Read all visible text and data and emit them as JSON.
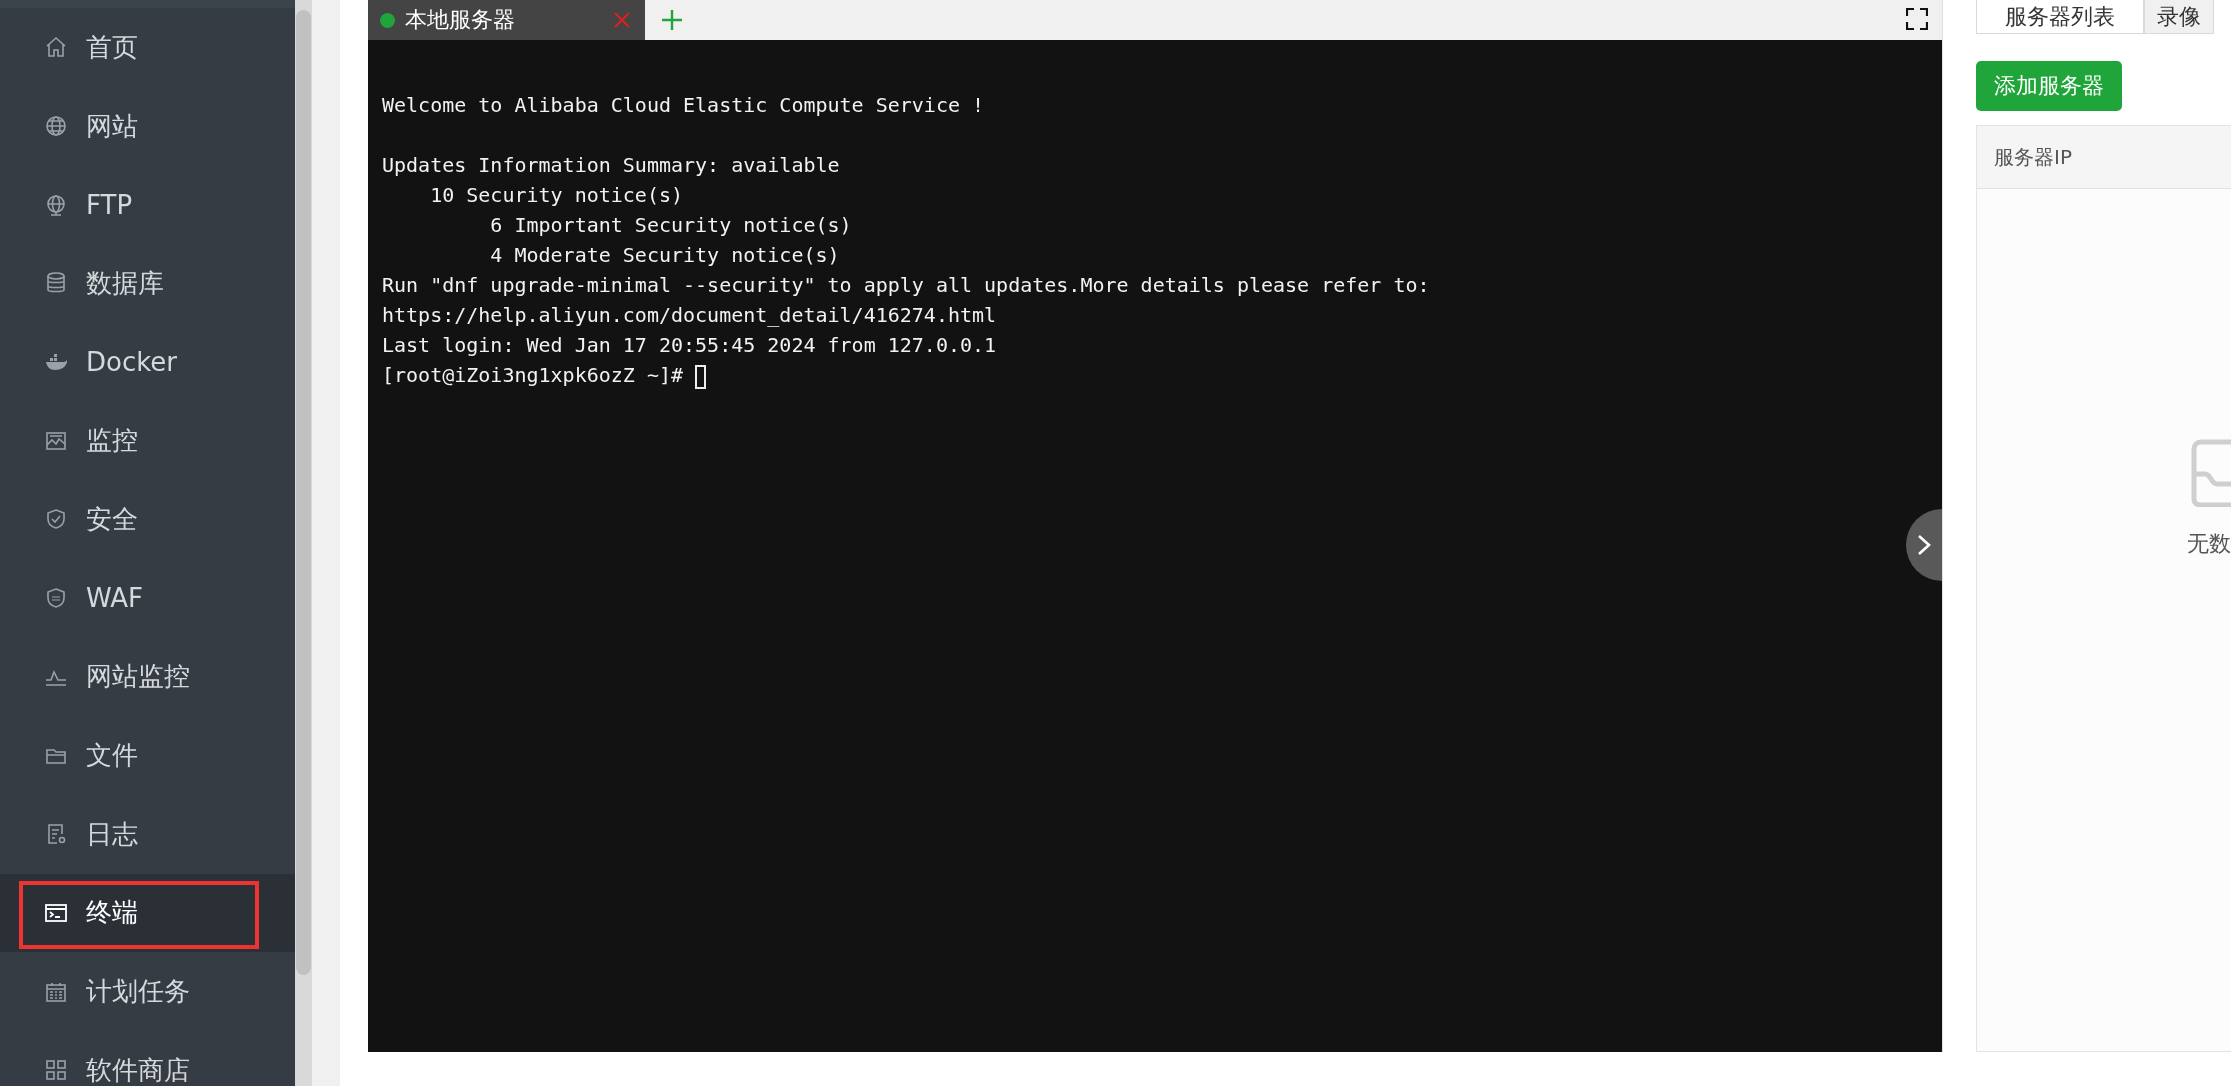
{
  "sidebar": {
    "items": [
      {
        "label": "首页",
        "kind": "home",
        "selected": false
      },
      {
        "label": "网站",
        "kind": "globe",
        "selected": false
      },
      {
        "label": "FTP",
        "kind": "ftp",
        "selected": false
      },
      {
        "label": "数据库",
        "kind": "database",
        "selected": false
      },
      {
        "label": "Docker",
        "kind": "docker",
        "selected": false
      },
      {
        "label": "监控",
        "kind": "monitor",
        "selected": false
      },
      {
        "label": "安全",
        "kind": "shield",
        "selected": false
      },
      {
        "label": "WAF",
        "kind": "waf",
        "selected": false
      },
      {
        "label": "网站监控",
        "kind": "pulse",
        "selected": false
      },
      {
        "label": "文件",
        "kind": "folder",
        "selected": false
      },
      {
        "label": "日志",
        "kind": "log",
        "selected": false
      },
      {
        "label": "终端",
        "kind": "terminal",
        "selected": true,
        "highlighted": true
      },
      {
        "label": "计划任务",
        "kind": "calendar",
        "selected": false
      },
      {
        "label": "软件商店",
        "kind": "apps",
        "selected": false
      }
    ]
  },
  "terminal": {
    "tabs": [
      {
        "label": "本地服务器",
        "connected": true,
        "selected": true
      }
    ],
    "lines": [
      "Welcome to Alibaba Cloud Elastic Compute Service !",
      "Updates Information Summary: available",
      "    10 Security notice(s)",
      "         6 Important Security notice(s)",
      "         4 Moderate Security notice(s)",
      "Run \"dnf upgrade-minimal --security\" to apply all updates.More details please refer to:",
      "https://help.aliyun.com/document_detail/416274.html",
      "Last login: Wed Jan 17 20:55:45 2024 from 127.0.0.1"
    ],
    "prompt": "[root@iZoi3ng1xpk6ozZ ~]# "
  },
  "right_panel": {
    "tabs": [
      {
        "label": "服务器列表",
        "selected": true
      },
      {
        "label": "录像",
        "selected": false
      }
    ],
    "add_button": "添加服务器",
    "table": {
      "columns": [
        "服务器IP"
      ],
      "empty_text": "无数"
    }
  }
}
